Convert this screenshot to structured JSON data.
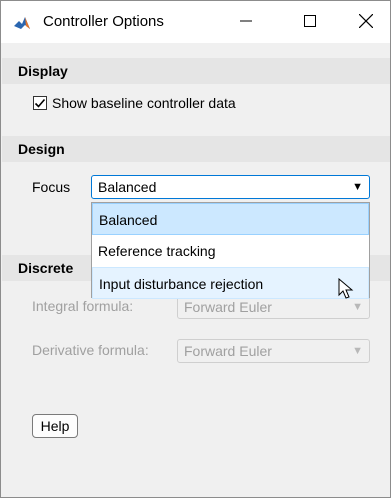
{
  "window": {
    "title": "Controller Options"
  },
  "display_section": {
    "header": "Display",
    "show_baseline": {
      "label": "Show baseline controller data",
      "checked": true
    }
  },
  "design_section": {
    "header": "Design",
    "focus_label": "Focus",
    "focus_value": "Balanced",
    "focus_options": [
      "Balanced",
      "Reference tracking",
      "Input disturbance rejection"
    ]
  },
  "discrete_section": {
    "header_visible": "Discrete",
    "integral_label": "Integral formula:",
    "integral_value": "Forward Euler",
    "derivative_label": "Derivative formula:",
    "derivative_value": "Forward Euler"
  },
  "help_button": {
    "label": "Help"
  },
  "icons": {
    "app": "matlab-icon",
    "minimize": "minimize-icon",
    "maximize": "maximize-icon",
    "close": "close-icon",
    "dropdown": "dropdown-arrow-icon",
    "cursor": "pointer-cursor-icon"
  },
  "colors": {
    "selected_item_bg": "#cce8ff",
    "hover_item_bg": "#e5f3ff",
    "section_header_bg": "#e5e5e5",
    "focus_border": "#0078d7",
    "disabled_text": "#a0a0a0"
  }
}
